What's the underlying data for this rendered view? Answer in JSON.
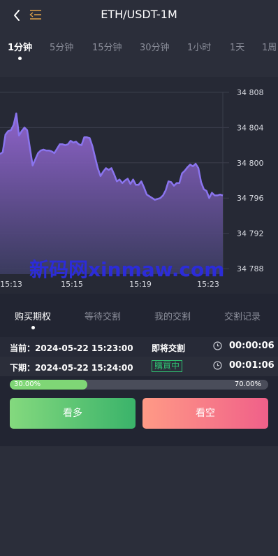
{
  "header": {
    "title": "ETH/USDT-1M",
    "back_icon": "chevron-left-icon",
    "menu_icon": "menu-icon"
  },
  "period_tabs": [
    {
      "label": "1分钟",
      "active": true
    },
    {
      "label": "5分钟",
      "active": false
    },
    {
      "label": "15分钟",
      "active": false
    },
    {
      "label": "30分钟",
      "active": false
    },
    {
      "label": "1小时",
      "active": false
    },
    {
      "label": "1天",
      "active": false
    },
    {
      "label": "1周",
      "active": false
    }
  ],
  "watermark": "新码网xinmaw.com",
  "chart_data": {
    "type": "area",
    "x_ticks": [
      "15:13",
      "15:15",
      "15:19",
      "15:23"
    ],
    "y_ticks": [
      "34 808",
      "34 804",
      "34 800",
      "34 796",
      "34 792",
      "34 788"
    ],
    "ylim": [
      34788,
      34808
    ],
    "series": [
      {
        "values": [
          34801.0,
          34801.2,
          34803.2,
          34803.6,
          34803.7,
          34804.3,
          34805.6,
          34803.1,
          34803.6,
          34804.0,
          34803.7,
          34801.7,
          34799.7,
          34800.4,
          34801.1,
          34801.4,
          34801.5,
          34801.4,
          34801.4,
          34801.3,
          34801.1,
          34801.6,
          34802.1,
          34802.1,
          34802.0,
          34802.1,
          34802.5,
          34802.3,
          34802.4,
          34802.1,
          34802.0,
          34802.9,
          34802.9,
          34802.8,
          34801.9,
          34800.6,
          34799.4,
          34798.5,
          34799.0,
          34799.4,
          34799.2,
          34799.4,
          34798.7,
          34797.9,
          34798.1,
          34797.7,
          34798.0,
          34798.2,
          34797.6,
          34798.1,
          34797.5,
          34797.5,
          34797.9,
          34797.2,
          34796.4,
          34796.2,
          34796.0,
          34795.8,
          34795.9,
          34796.0,
          34796.3,
          34796.9,
          34797.9,
          34797.8,
          34797.4,
          34797.7,
          34797.7,
          34798.8,
          34799.1,
          34799.5,
          34799.8,
          34799.6,
          34799.9,
          34799.4,
          34797.8,
          34797.0,
          34796.8,
          34796.0,
          34796.6,
          34796.3,
          34796.3,
          34796.4,
          34796.3
        ]
      }
    ],
    "colors": {
      "line": "#8a74ee",
      "fill_top": "#9466d2",
      "fill_bottom": "#3c3d62",
      "grid": "#3b3e4c"
    }
  },
  "trade_tabs": [
    {
      "label": "购买期权",
      "active": true
    },
    {
      "label": "等待交割",
      "active": false
    },
    {
      "label": "我的交割",
      "active": false
    },
    {
      "label": "交割记录",
      "active": false
    }
  ],
  "current": {
    "label": "当前：2024-05-22 15:23:00",
    "status": "即将交割",
    "countdown": "00:00:06"
  },
  "next": {
    "label": "下期：2024-05-22 15:24:00",
    "status": "購買中",
    "countdown": "00:01:06"
  },
  "progress": {
    "left_text": "30.00%",
    "right_text": "70.00%",
    "left_fraction": 0.3
  },
  "buttons": {
    "long_label": "看多",
    "short_label": "看空"
  }
}
